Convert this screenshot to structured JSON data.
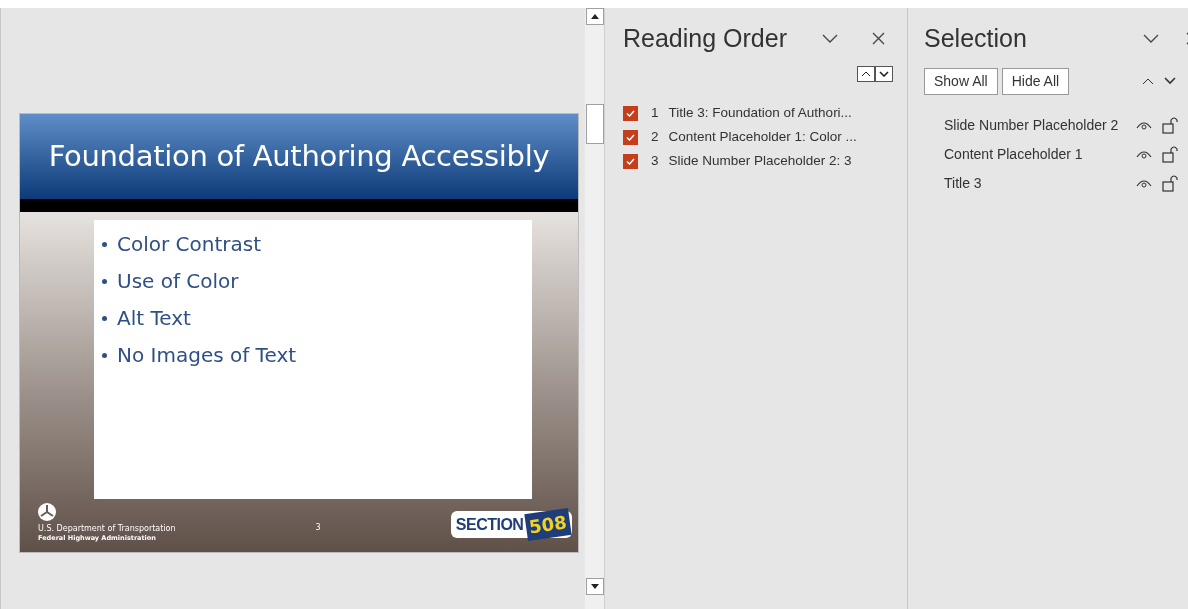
{
  "slide": {
    "title": "Foundation of Authoring Accessibly",
    "bullets": [
      "Color Contrast",
      "Use of Color",
      "Alt Text",
      "No Images of Text"
    ],
    "footer": {
      "department": "U.S. Department of Transportation",
      "agency": "Federal Highway Administration",
      "slide_number": "3",
      "logo_word": "SECTION",
      "logo_number": "508"
    }
  },
  "reading_order": {
    "title": "Reading Order",
    "items": [
      {
        "number": "1",
        "label": "Title 3: Foundation of Authori...",
        "checked": true
      },
      {
        "number": "2",
        "label": "Content Placeholder 1: Color ...",
        "checked": true
      },
      {
        "number": "3",
        "label": "Slide Number Placeholder 2: 3",
        "checked": true
      }
    ]
  },
  "selection": {
    "title": "Selection",
    "buttons": [
      "Show All",
      "Hide All"
    ],
    "items": [
      {
        "label": "Slide Number Placeholder 2",
        "visible": true,
        "locked": false
      },
      {
        "label": "Content Placeholder 1",
        "visible": true,
        "locked": false
      },
      {
        "label": "Title 3",
        "visible": true,
        "locked": false
      }
    ]
  }
}
